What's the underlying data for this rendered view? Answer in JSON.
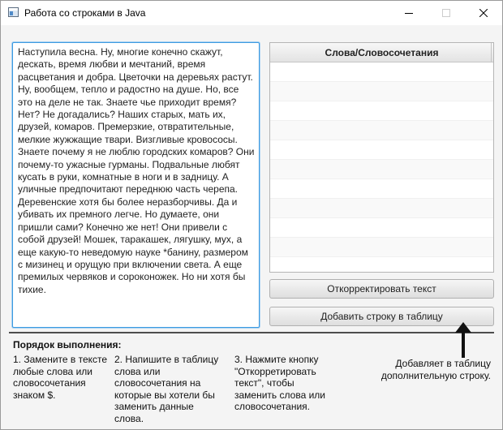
{
  "window": {
    "title": "Работа со строками в Java"
  },
  "text_area": {
    "value": "Наступила весна. Ну, многие конечно скажут, дескать, время любви и мечтаний, время расцветания и добра. Цветочки на деревьях растут. Ну, вообщем, тепло и радостно на душе. Но, все это на деле не так. Знаете чье приходит время? Нет? Не догадались? Наших старых, мать их, друзей, комаров. Премерзкие, отвратительные, мелкие жужжащие твари. Визгливые кровососы. Знаете почему я не люблю городских комаров? Они почему-то ужасные гурманы. Подвальные любят кусать в руки, комнатные в ноги и в задницу. А уличные предпочитают переднюю часть черепа. Деревенские хотя бы более неразборчивы. Да и убивать их премного легче. Но думаете, они пришли сами? Конечно же нет! Они привели с собой друзей! Мошек, таракашек, лягушку, мух, а еще какую-то неведомую науке *банину, размером с мизинец и орущую при включении света. А еще премилых червяков и сороконожек. Но ни хотя бы тихие."
  },
  "table": {
    "header": "Слова/Словосочетания",
    "rows": [
      "",
      "",
      "",
      "",
      "",
      "",
      "",
      "",
      "",
      "",
      ""
    ]
  },
  "buttons": {
    "correct_label": "Откорректировать текст",
    "add_row_label": "Добавить строку в таблицу"
  },
  "instructions": {
    "title": "Порядок выполнения:",
    "step1": "1. Замените в тексте любые слова или словосочетания знаком $.",
    "step2": "2. Напишите в таблицу слова или словосочетания на которые вы хотели бы заменить данные слова.",
    "step3": "3. Нажмите кнопку \"Откорретировать текст\", чтобы заменить слова или словосочетания.",
    "note": "Добавляет в таблицу дополнительную строку."
  },
  "icons": {
    "app": "java-app-icon",
    "minimize": "minimize-icon",
    "maximize": "maximize-icon",
    "close": "close-icon",
    "arrow": "arrow-up-icon"
  }
}
